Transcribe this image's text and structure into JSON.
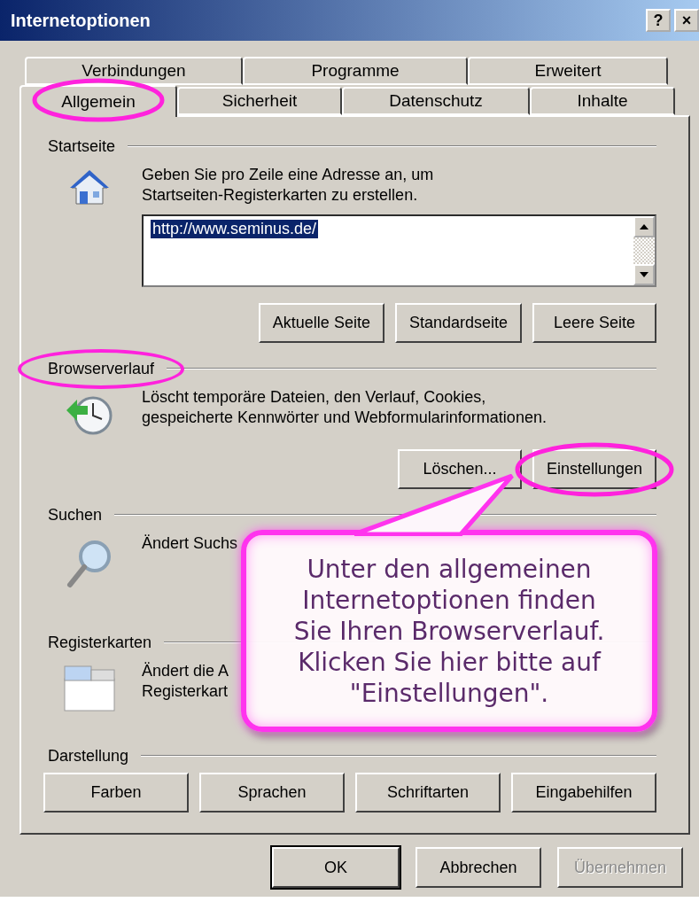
{
  "window": {
    "title": "Internetoptionen",
    "controls": [
      "?",
      "×"
    ]
  },
  "tabs": {
    "back_row": [
      {
        "label": "Verbindungen",
        "selected": false,
        "highlighted": false
      },
      {
        "label": "Programme",
        "selected": false,
        "highlighted": false
      },
      {
        "label": "Erweitert",
        "selected": false,
        "highlighted": false
      }
    ],
    "front_row": [
      {
        "label": "Allgemein",
        "selected": true,
        "highlighted": true
      },
      {
        "label": "Sicherheit",
        "selected": false,
        "highlighted": false
      },
      {
        "label": "Datenschutz",
        "selected": false,
        "highlighted": false
      },
      {
        "label": "Inhalte",
        "selected": false,
        "highlighted": false
      }
    ]
  },
  "sections": [
    {
      "kind": "homepage",
      "title": "Startseite",
      "highlighted": false,
      "description_lines": [
        "Geben Sie pro Zeile eine Adresse an, um",
        "Startseiten-Registerkarten zu erstellen."
      ],
      "url": "http://www.seminus.de/",
      "buttons": [
        {
          "label": "Aktuelle Seite",
          "highlighted": false
        },
        {
          "label": "Standardseite",
          "highlighted": false
        },
        {
          "label": "Leere Seite",
          "highlighted": false
        }
      ]
    },
    {
      "kind": "history",
      "title": "Browserverlauf",
      "highlighted": true,
      "description_lines": [
        "Löscht temporäre Dateien, den Verlauf, Cookies,",
        "gespeicherte Kennwörter und Webformularinformationen."
      ],
      "buttons": [
        {
          "label": "Löschen...",
          "highlighted": false
        },
        {
          "label": "Einstellungen",
          "highlighted": true
        }
      ]
    },
    {
      "kind": "search",
      "title": "Suchen",
      "highlighted": false,
      "description_lines": [
        "Ändert Suchs"
      ]
    },
    {
      "kind": "tabs",
      "title": "Registerkarten",
      "highlighted": false,
      "description_lines": [
        "Ändert die A",
        "Registerkart"
      ]
    },
    {
      "kind": "appearance",
      "title": "Darstellung",
      "highlighted": false,
      "buttons": [
        {
          "label": "Farben",
          "highlighted": false
        },
        {
          "label": "Sprachen",
          "highlighted": false
        },
        {
          "label": "Schriftarten",
          "highlighted": false
        },
        {
          "label": "Eingabehilfen",
          "highlighted": false
        }
      ]
    }
  ],
  "callout": {
    "lines": [
      "Unter den allgemeinen",
      "Internetoptionen finden",
      "Sie Ihren Browserverlauf.",
      "Klicken Sie hier bitte auf",
      "\"Einstellungen\"."
    ]
  },
  "dialog_buttons": [
    {
      "label": "OK",
      "default": true,
      "disabled": false
    },
    {
      "label": "Abbrechen",
      "default": false,
      "disabled": false
    },
    {
      "label": "Übernehmen",
      "default": false,
      "disabled": true
    }
  ]
}
